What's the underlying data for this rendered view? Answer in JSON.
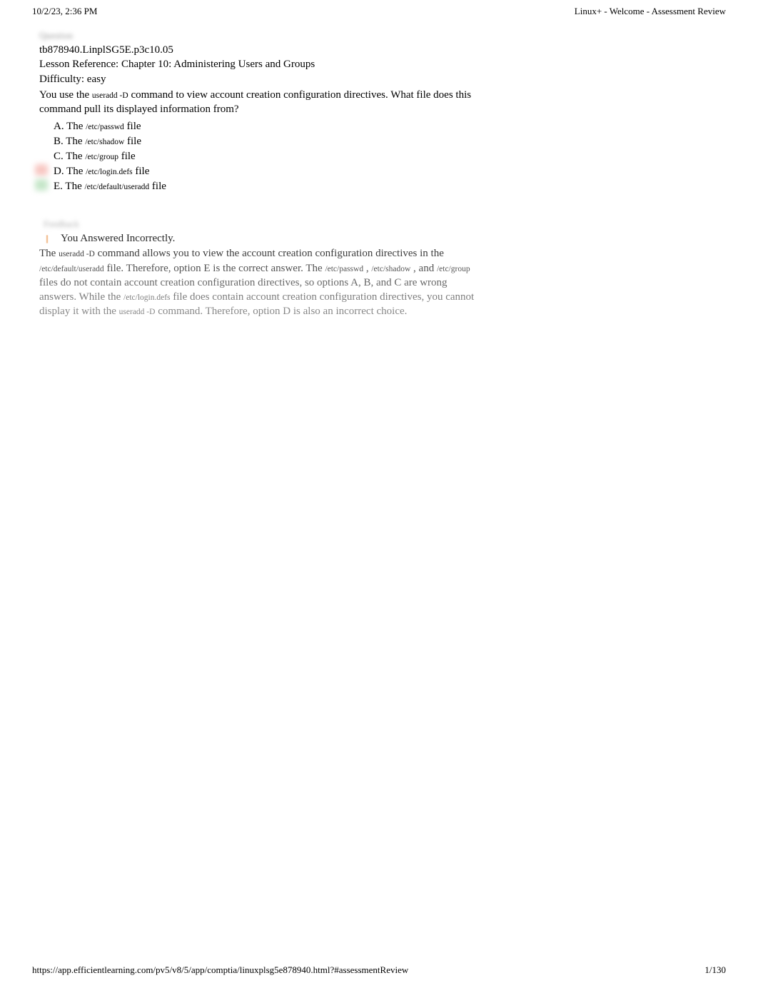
{
  "header": {
    "timestamp": "10/2/23, 2:36 PM",
    "title": "Linux+ - Welcome - Assessment Review"
  },
  "question": {
    "blur_label": "Question",
    "id": "tb878940.LinplSG5E.p3c10.05",
    "lesson_reference": "Lesson Reference: Chapter 10: Administering Users and Groups",
    "difficulty": "Difficulty: easy",
    "stem_prefix": "You use the ",
    "stem_code": "useradd -D",
    "stem_suffix": " command to view account creation configuration directives. What file does this command pull its displayed information from?",
    "options": [
      {
        "letter": "A.",
        "prefix": " The",
        "code": "/etc/passwd",
        "suffix": " file",
        "marker": ""
      },
      {
        "letter": "B.",
        "prefix": " The ",
        "code": "/etc/shadow",
        "suffix": " file",
        "marker": ""
      },
      {
        "letter": "C.",
        "prefix": " The ",
        "code": "/etc/group",
        "suffix": " file",
        "marker": ""
      },
      {
        "letter": "D.",
        "prefix": " The",
        "code": "/etc/login.defs",
        "suffix": " file",
        "marker": "wrong"
      },
      {
        "letter": "E.",
        "prefix": " The",
        "code": "/etc/default/useradd",
        "suffix": " file",
        "marker": "correct"
      }
    ]
  },
  "feedback": {
    "blur_label": "Feedback",
    "title": "You Answered Incorrectly.",
    "explanation_parts": {
      "p1": "The ",
      "c1": "useradd -D",
      "p2": " command allows you to view the account creation configuration directives in the ",
      "c2": "/etc/default/useradd",
      "p3": " file. Therefore, option E is the correct answer. The ",
      "c3": "/etc/passwd",
      "p4": " , ",
      "c4": "/etc/shadow",
      "p5": " , and ",
      "c5": "/etc/group",
      "p6": " files do not contain account creation configuration directives, so options A, B, and C are wrong answers. While the ",
      "c6": "/etc/login.defs",
      "p7": " file does contain account creation configuration directives, you cannot display it with the ",
      "c7": "useradd -D",
      "p8": " command. Therefore, option D is also an incorrect choice."
    }
  },
  "footer": {
    "url": "https://app.efficientlearning.com/pv5/v8/5/app/comptia/linuxplsg5e878940.html?#assessmentReview",
    "page": "1/130"
  }
}
